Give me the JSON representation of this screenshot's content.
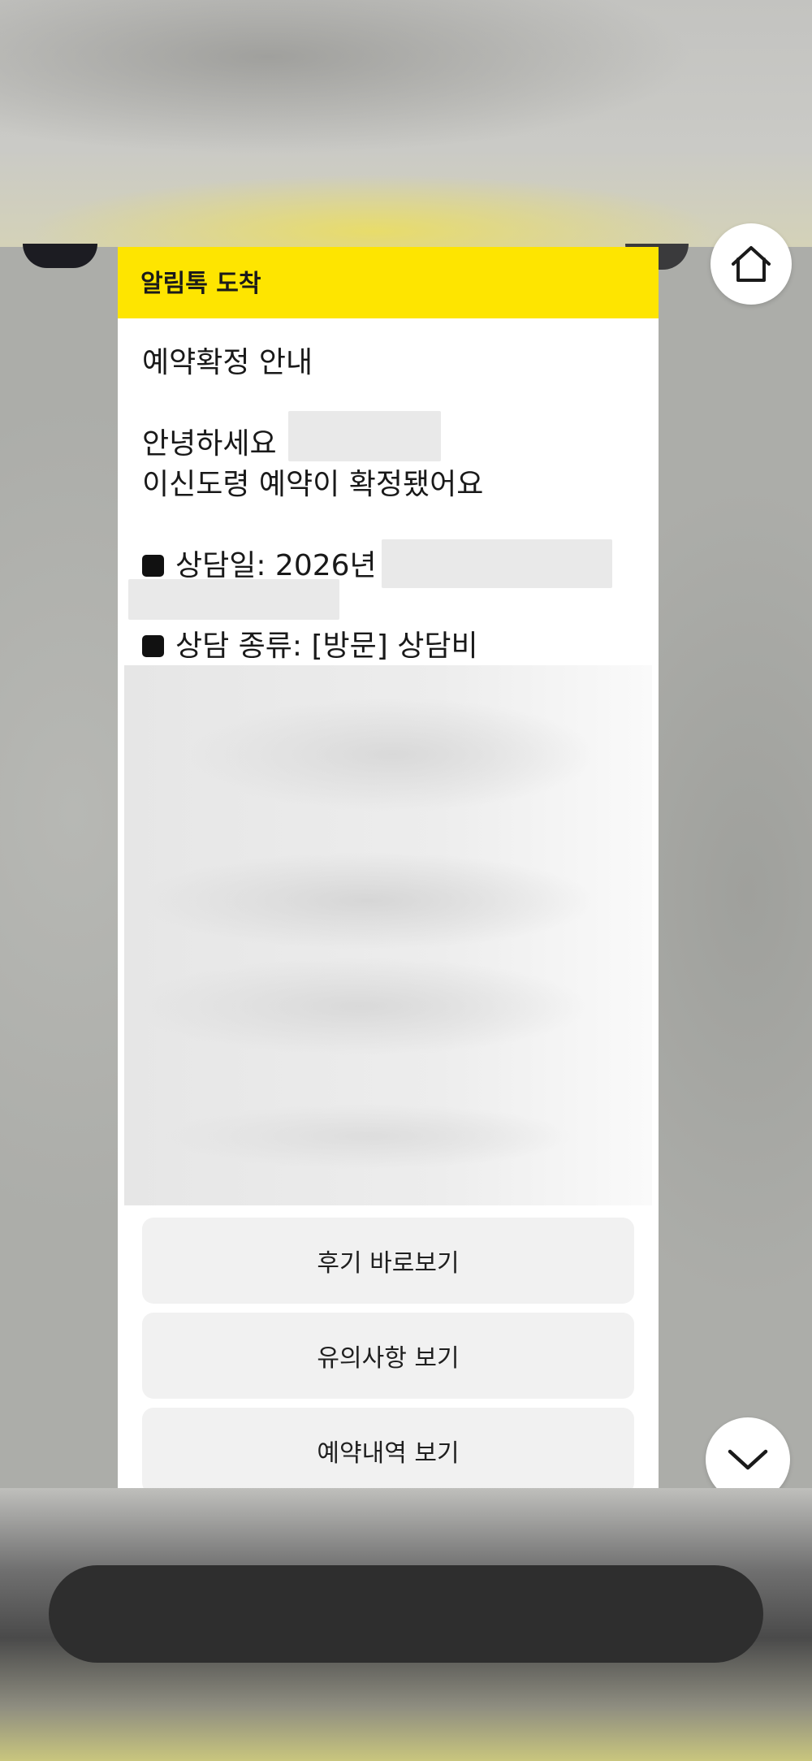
{
  "notification": {
    "header": "알림톡 도착",
    "title": "예약확정 안내",
    "greeting": "안녕하세요",
    "confirm_line": "이신도령 예약이 확정됐어요",
    "date_label": "상담일: 2026년",
    "type_label": "상담 종류: [방문] 상담비"
  },
  "buttons": {
    "review": "후기 바로보기",
    "notice": "유의사항 보기",
    "reservation": "예약내역 보기"
  },
  "colors": {
    "header_bg": "#fee500",
    "button_bg": "#f1f1f1"
  },
  "icons": {
    "home": "home-icon",
    "scroll_down": "chevron-down-icon"
  }
}
